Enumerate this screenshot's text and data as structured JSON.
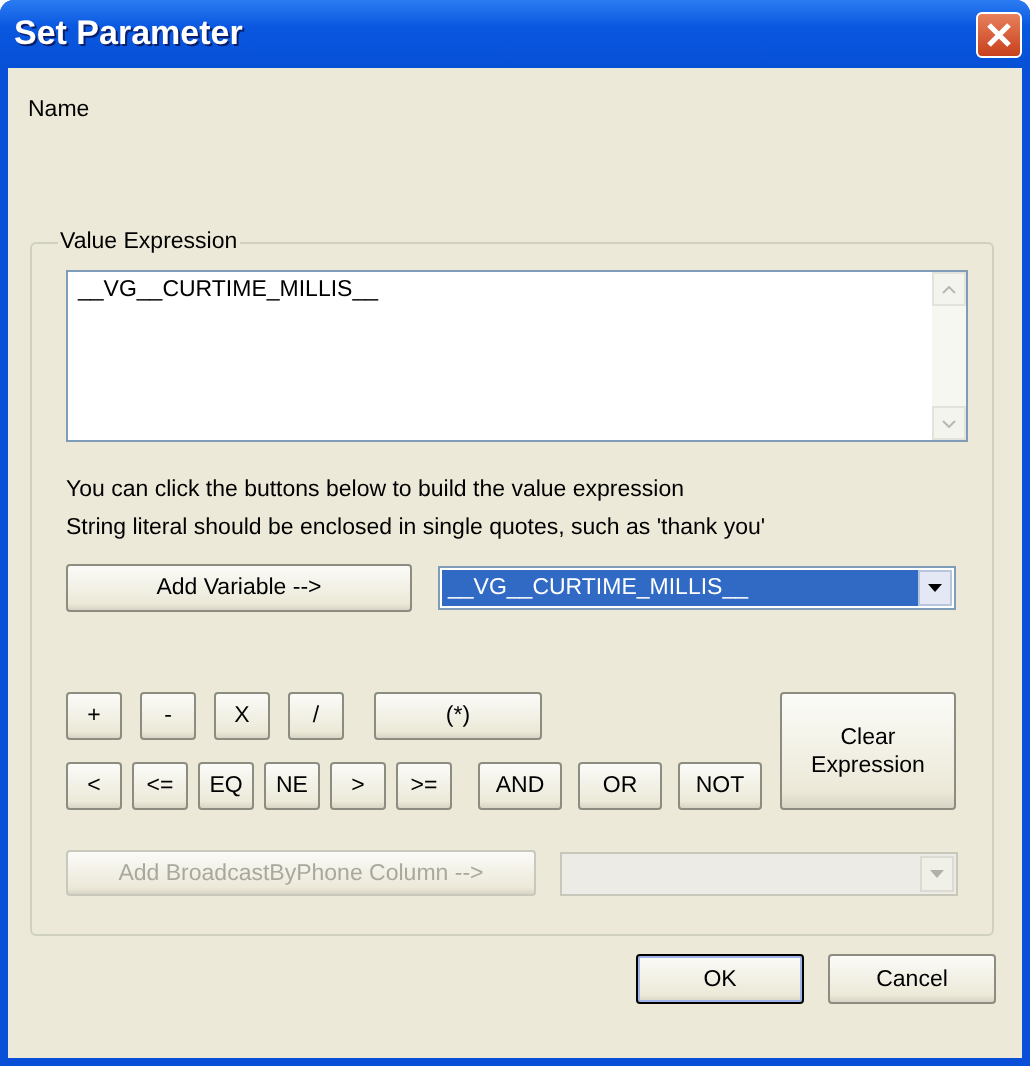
{
  "window": {
    "title": "Set Parameter"
  },
  "name_label": "Name",
  "value_expression": {
    "legend": "Value Expression",
    "expression": "__VG__CURTIME_MILLIS__",
    "hint_lines": [
      "You can click the buttons below to build the value expression",
      "String literal should be enclosed in single quotes, such as 'thank you'"
    ],
    "add_variable_button": {
      "label": "Add Variable -->"
    },
    "variable_dropdown": {
      "value": "__VG__CURTIME_MILLIS__",
      "highlighted": true
    },
    "operator_rows": [
      [
        {
          "label": "+",
          "kind": "small"
        },
        {
          "label": "-",
          "kind": "small"
        },
        {
          "label": "X",
          "kind": "small"
        },
        {
          "label": "/",
          "kind": "small"
        },
        {
          "label": "(*)",
          "kind": "wide"
        }
      ],
      [
        {
          "label": "<",
          "kind": "small"
        },
        {
          "label": "<=",
          "kind": "small"
        },
        {
          "label": "EQ",
          "kind": "small"
        },
        {
          "label": "NE",
          "kind": "small"
        },
        {
          "label": ">",
          "kind": "small"
        },
        {
          "label": ">=",
          "kind": "small"
        },
        {
          "label": "AND",
          "kind": "logic"
        },
        {
          "label": "OR",
          "kind": "logic"
        },
        {
          "label": "NOT",
          "kind": "logic"
        }
      ]
    ],
    "clear_button": {
      "label": "Clear Expression"
    },
    "column_button": {
      "label": "Add BroadcastByPhone Column -->",
      "disabled": true
    },
    "column_dropdown": {
      "disabled": true
    }
  },
  "buttons": [
    {
      "label": "OK",
      "default": true
    },
    {
      "label": "Cancel",
      "default": false
    }
  ]
}
